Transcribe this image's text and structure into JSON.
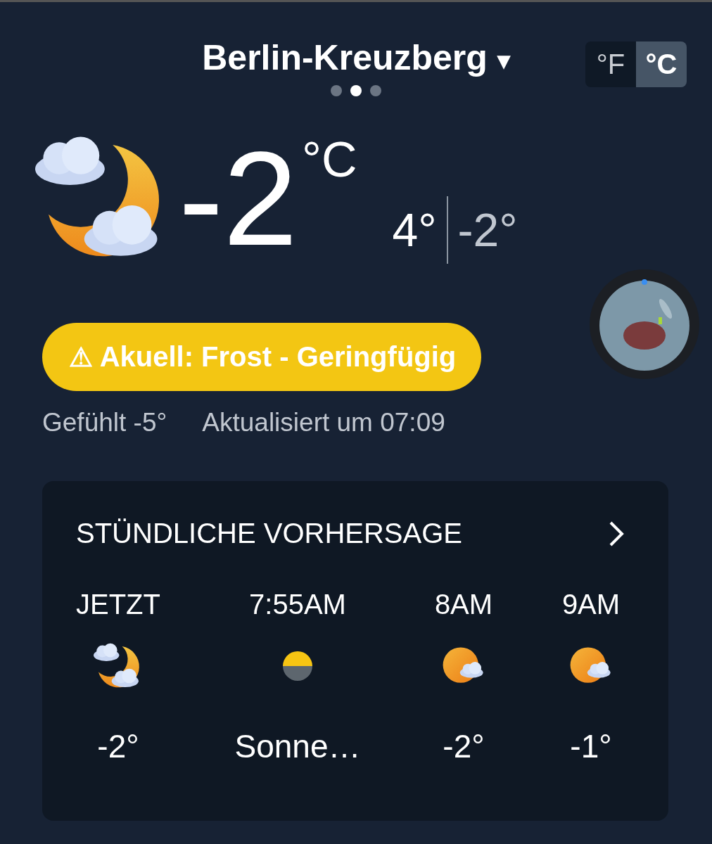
{
  "location": {
    "title": "Berlin-Kreuzberg",
    "caret": "▾"
  },
  "page_dots": [
    {
      "selected": false
    },
    {
      "selected": true
    },
    {
      "selected": false
    }
  ],
  "units": [
    {
      "label": "°F",
      "selected": false
    },
    {
      "label": "°C",
      "selected": true
    }
  ],
  "current": {
    "kind": "moon-cloud",
    "temperature": "-2",
    "unit": "°C",
    "high": "4°",
    "low": "-2°"
  },
  "alert": {
    "icon": "⚠",
    "text": "Akuell: Frost - Geringfügig"
  },
  "feels_like": "Gefühlt -5°",
  "updated": "Aktualisiert um 07:09",
  "hourly": {
    "title": "STÜNDLICHE VORHERSAGE",
    "items": [
      {
        "time": "JETZT",
        "kind": "moon-cloud",
        "value": "-2°"
      },
      {
        "time": "7:55AM",
        "kind": "sunrise",
        "value": "Sonne…"
      },
      {
        "time": "8AM",
        "kind": "sun-cloud",
        "value": "-2°"
      },
      {
        "time": "9AM",
        "kind": "sun-cloud",
        "value": "-1°"
      }
    ]
  }
}
